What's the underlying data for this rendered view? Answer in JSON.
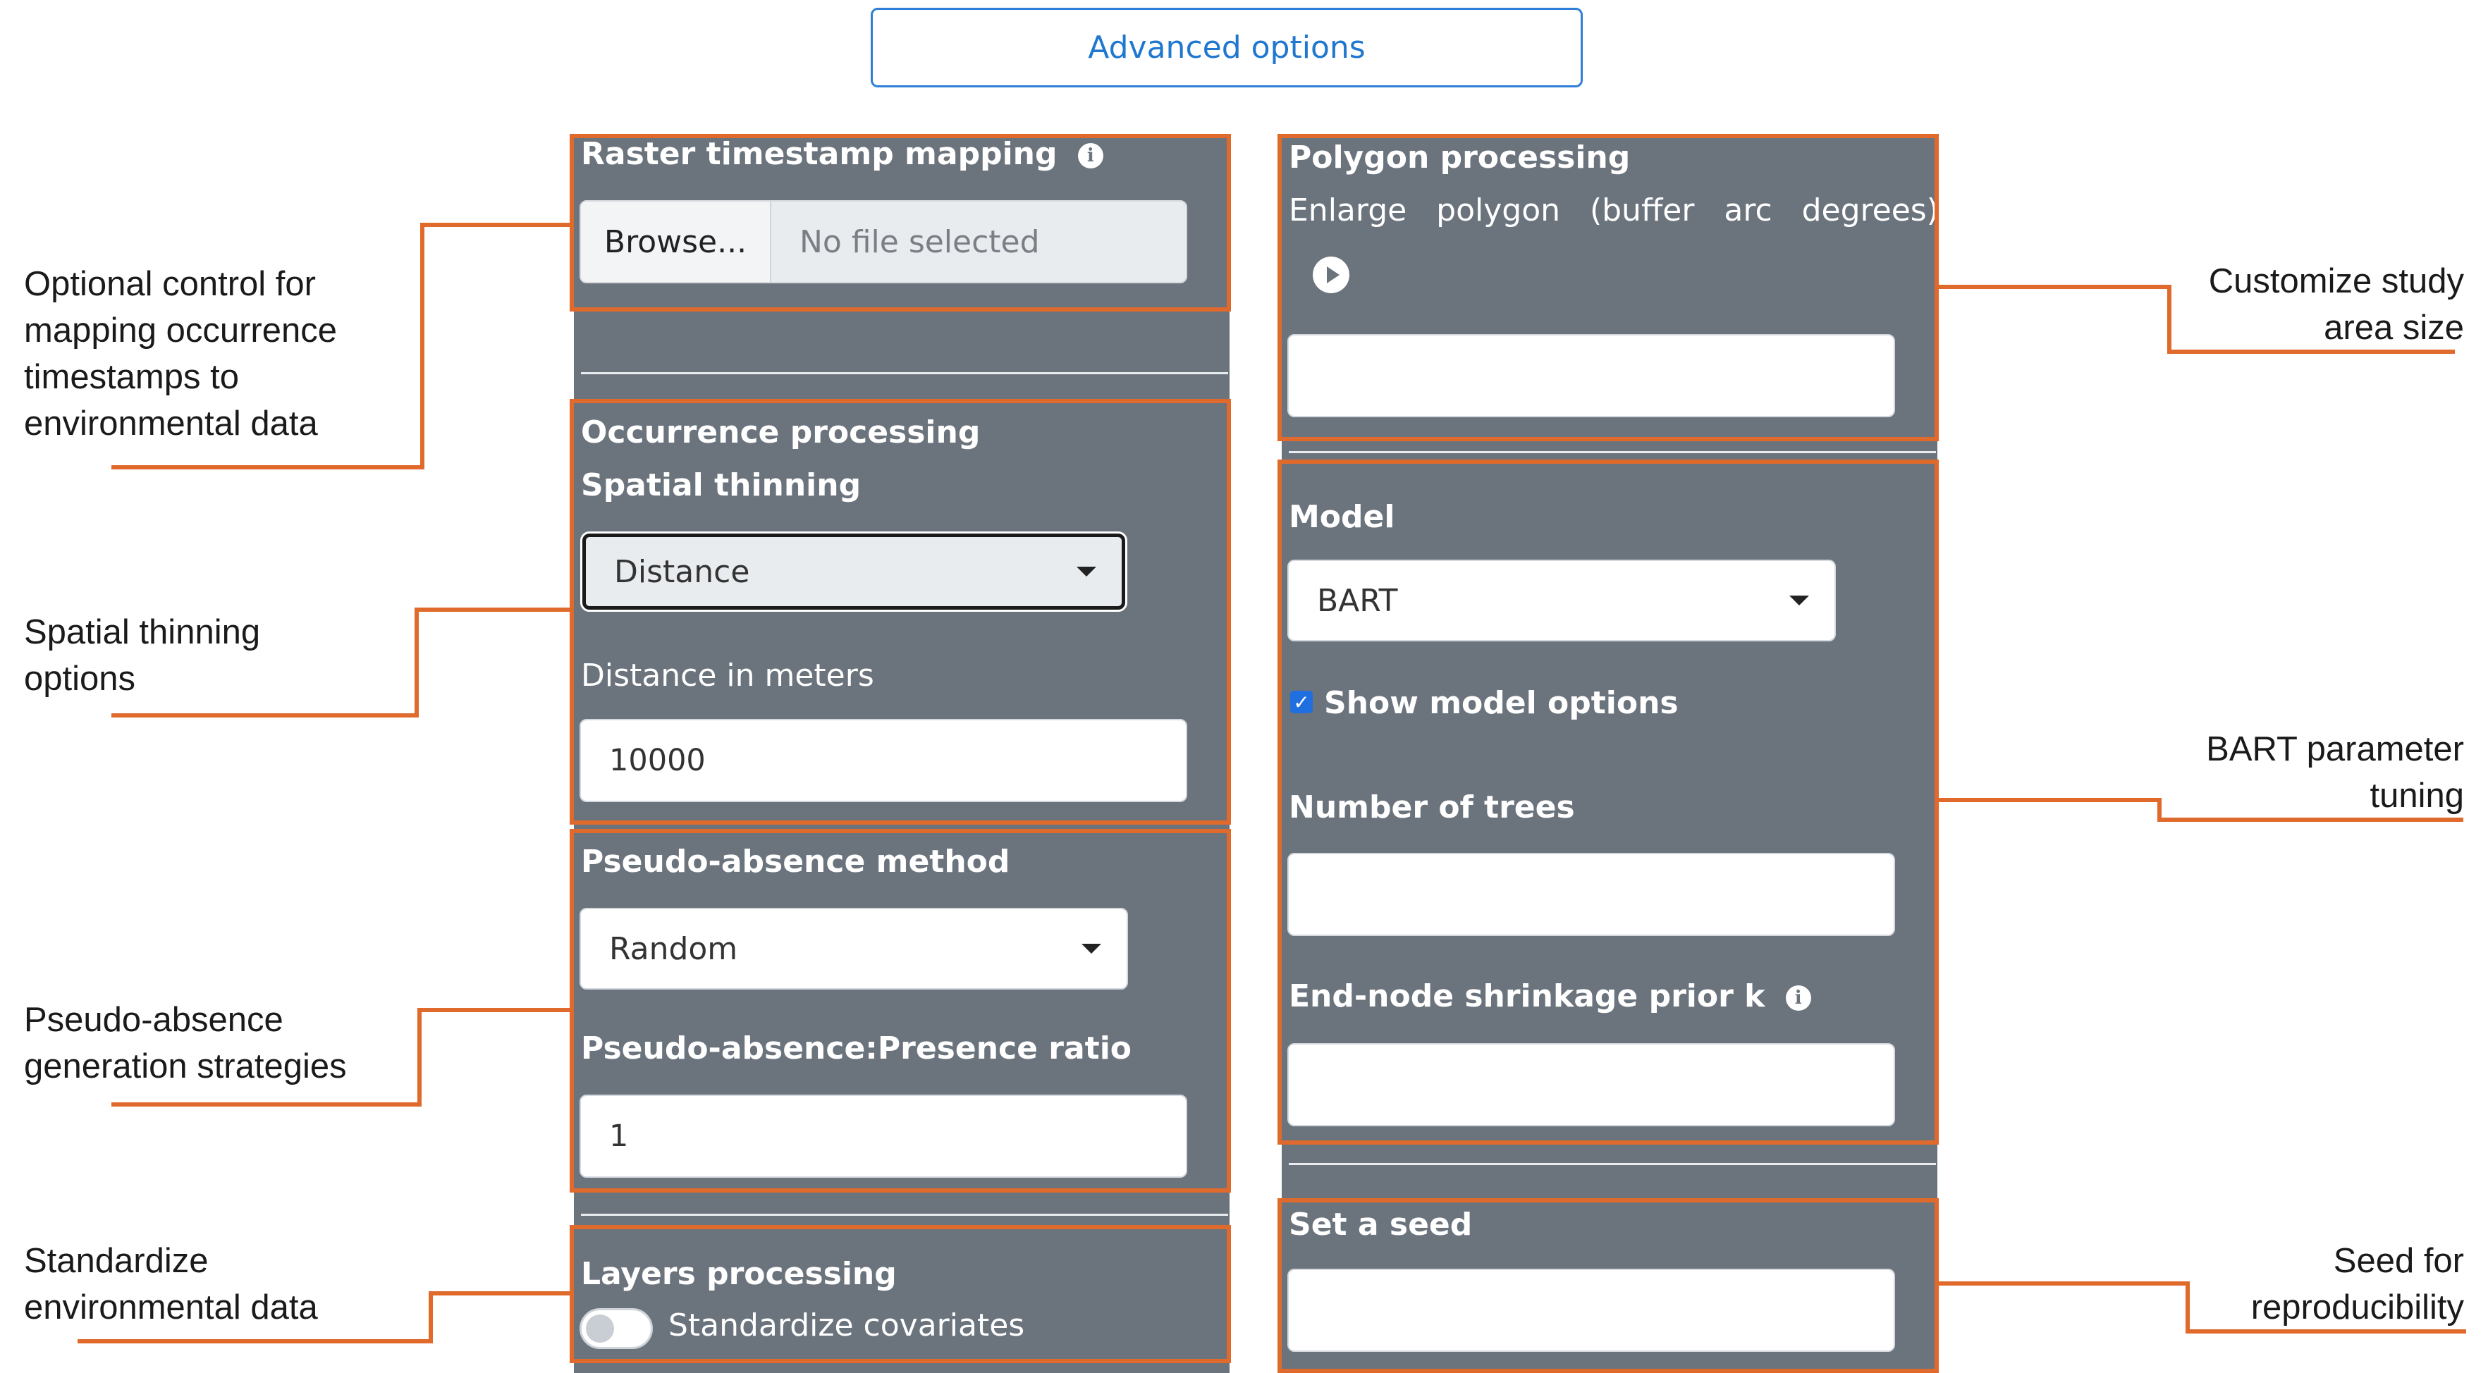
{
  "advanced_button": {
    "label": "Advanced options"
  },
  "left": {
    "raster": {
      "title": "Raster timestamp mapping",
      "browse_label": "Browse...",
      "file_status": "No file selected"
    },
    "occurrence": {
      "title": "Occurrence processing",
      "thinning_label": "Spatial thinning",
      "thinning_value": "Distance",
      "distance_label": "Distance in meters",
      "distance_value": "10000"
    },
    "pseudo": {
      "method_label": "Pseudo-absence method",
      "method_value": "Random",
      "ratio_label": "Pseudo-absence:Presence ratio",
      "ratio_value": "1"
    },
    "layers": {
      "title": "Layers processing",
      "standardize_label": "Standardize covariates",
      "standardize_on": false
    }
  },
  "right": {
    "polygon": {
      "title": "Polygon processing",
      "enlarge_label": "Enlarge   polygon   (buffer   arc   degrees)",
      "value": ""
    },
    "model": {
      "title": "Model",
      "model_value": "BART",
      "show_options_label": "Show model options",
      "show_options_checked": true,
      "trees_label": "Number of trees",
      "trees_value": "",
      "shrinkage_label": "End-node shrinkage prior k",
      "shrinkage_value": ""
    },
    "seed": {
      "title": "Set a seed",
      "value": ""
    }
  },
  "annotations": {
    "raster": "Optional control for mapping occurrence timestamps to environmental data",
    "raster_lines": [
      "Optional control for",
      "mapping occurrence",
      "timestamps to",
      "environmental data"
    ],
    "thinning_lines": [
      "Spatial thinning",
      "options"
    ],
    "pseudo_lines": [
      "Pseudo-absence",
      "generation strategies"
    ],
    "standardize_lines": [
      "Standardize",
      "environmental data"
    ],
    "study_lines": [
      "Customize study",
      "area size"
    ],
    "bart_lines": [
      "BART parameter",
      "tuning"
    ],
    "seed_lines": [
      "Seed for",
      "reproducibility"
    ]
  },
  "colors": {
    "panel": "#6b737d",
    "highlight": "#e06a2c",
    "accent": "#1f77d0"
  }
}
